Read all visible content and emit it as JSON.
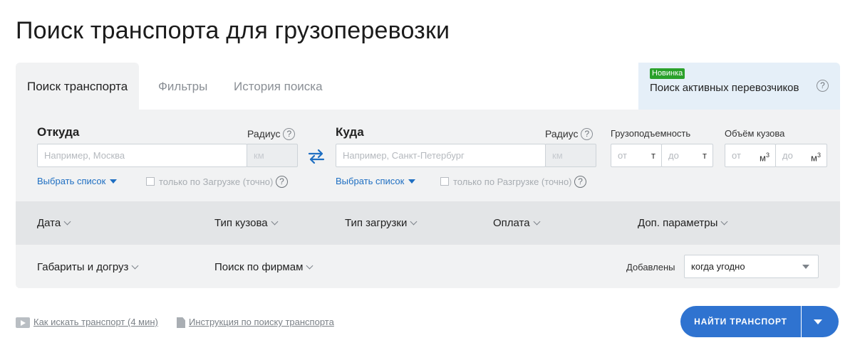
{
  "page": {
    "title": "Поиск транспорта для грузоперевозки"
  },
  "tabs": [
    {
      "label": "Поиск транспорта",
      "active": true
    },
    {
      "label": "Фильтры",
      "active": false
    },
    {
      "label": "История поиска",
      "active": false
    }
  ],
  "promo": {
    "badge": "Новинка",
    "label": "Поиск активных перевозчиков",
    "help": "?"
  },
  "from": {
    "label": "Откуда",
    "radius_label": "Радиус",
    "placeholder": "Например, Москва",
    "radius_placeholder": "км",
    "select_list": "Выбрать список",
    "only_label": "только по Загрузке (точно)"
  },
  "to": {
    "label": "Куда",
    "radius_label": "Радиус",
    "placeholder": "Например, Санкт-Петербург",
    "radius_placeholder": "км",
    "select_list": "Выбрать список",
    "only_label": "только по Разгрузке (точно)"
  },
  "capacity": {
    "label": "Грузоподъемность",
    "from_placeholder": "от",
    "to_placeholder": "до",
    "unit": "т"
  },
  "volume": {
    "label": "Объём кузова",
    "from_placeholder": "от",
    "to_placeholder": "до",
    "unit": "м",
    "unit_power": "3"
  },
  "filters_row1": [
    "Дата",
    "Тип кузова",
    "Тип загрузки",
    "Оплата",
    "Доп. параметры"
  ],
  "filters_row2": [
    "Габариты и догруз",
    "Поиск по фирмам"
  ],
  "added": {
    "label": "Добавлены",
    "value": "когда угодно"
  },
  "footer": {
    "video_link": "Как искать транспорт (4 мин)",
    "doc_link": "Инструкция по поиску транспорта"
  },
  "search_button": {
    "label": "НАЙТИ ТРАНСПОРТ"
  },
  "colors": {
    "accent": "#2f73d0",
    "badge": "#2aa12a",
    "link": "#1f6fc2"
  }
}
